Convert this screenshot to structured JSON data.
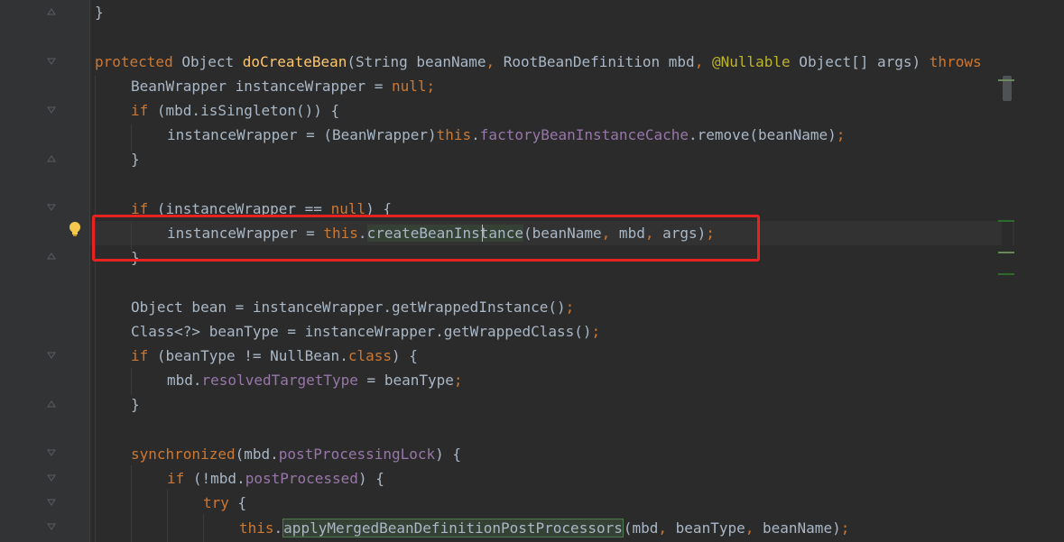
{
  "editor": {
    "lines": {
      "l01": {
        "brace": "}"
      },
      "l02": {
        "kw_protected": "protected",
        "type_object": " Object ",
        "method_name": "doCreateBean",
        "params_1": "(String beanName",
        "comma_1": ",",
        "params_2": " RootBeanDefinition mbd",
        "comma_2": ",",
        "space": " ",
        "annotation": "@Nullable",
        "params_3": " Object[] args) ",
        "kw_throws": "throws"
      },
      "l03": {
        "text_1": "BeanWrapper instanceWrapper = ",
        "kw_null": "null",
        "semi": ";"
      },
      "l04": {
        "kw_if": "if",
        "text_1": " (mbd.isSingleton()) {"
      },
      "l05": {
        "text_1": "instanceWrapper = (BeanWrapper)",
        "kw_this": "this",
        "dot": ".",
        "field": "factoryBeanInstanceCache",
        "text_2": ".remove(beanName)",
        "semi": ";"
      },
      "l06": {
        "brace": "}"
      },
      "l07": {
        "kw_if": "if",
        "text_1": " (instanceWrapper == ",
        "kw_null": "null",
        "text_2": ") {"
      },
      "l08": {
        "text_1": "instanceWrapper = ",
        "kw_this": "this",
        "dot": ".",
        "method": "createBeanInstance",
        "text_2": "(beanName",
        "comma_1": ",",
        "text_3": " mbd",
        "comma_2": ",",
        "text_4": " args)",
        "semi": ";"
      },
      "l09": {
        "brace": "}"
      },
      "l10": {
        "text_1": "Object bean = instanceWrapper.getWrappedInstance()",
        "semi": ";"
      },
      "l11": {
        "text_1": "Class<?> beanType = instanceWrapper.getWrappedClass()",
        "semi": ";"
      },
      "l12": {
        "kw_if": "if",
        "text_1": " (beanType != NullBean.",
        "kw_class": "class",
        "text_2": ") {"
      },
      "l13": {
        "text_1": "mbd.",
        "field": "resolvedTargetType",
        "text_2": " = beanType",
        "semi": ";"
      },
      "l14": {
        "brace": "}"
      },
      "l15": {
        "kw_sync": "synchronized",
        "text_1": "(mbd.",
        "field": "postProcessingLock",
        "text_2": ") {"
      },
      "l16": {
        "kw_if": "if",
        "text_1": " (!mbd.",
        "field": "postProcessed",
        "text_2": ") {"
      },
      "l17": {
        "kw_try": "try",
        "text_1": " {"
      },
      "l18": {
        "kw_this": "this",
        "dot": ".",
        "method": "applyMergedBeanDefinitionPostProcessors",
        "text_1": "(mbd",
        "comma_1": ",",
        "text_2": " beanType",
        "comma_2": ",",
        "text_3": " beanName)",
        "semi": ";"
      }
    },
    "colors": {
      "background": "#2b2b2b",
      "gutter": "#313335",
      "keyword": "#cc7832",
      "method_declaration": "#ffc66d",
      "field": "#9876aa",
      "annotation": "#bbb529",
      "default_text": "#a9b7c6",
      "highlight_box": "#e8231f"
    },
    "icons": {
      "intention": "lightbulb-icon",
      "fold": "fold-marker-icon"
    }
  }
}
